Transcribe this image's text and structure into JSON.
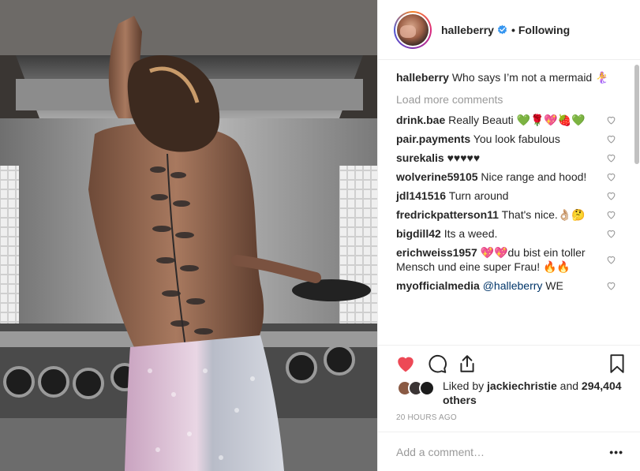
{
  "post": {
    "author": "halleberry",
    "follow_state": "Following",
    "separator": "•",
    "caption": {
      "user": "halleberry",
      "text": "Who says I’m not a mermaid 🧜‍♀️"
    },
    "load_more": "Load more comments",
    "comments": [
      {
        "user": "drink.bae",
        "text": "Really Beauti 💚🌹💖🍓💚"
      },
      {
        "user": "pair.payments",
        "text": "You look fabulous"
      },
      {
        "user": "surekalis",
        "text": "♥♥♥♥♥"
      },
      {
        "user": "wolverine59105",
        "text": "Nice range and hood!"
      },
      {
        "user": "jdl141516",
        "text": "Turn around"
      },
      {
        "user": "fredrickpatterson11",
        "text": "That's nice.👌🏼🤔"
      },
      {
        "user": "bigdill42",
        "text": "Its a weed."
      },
      {
        "user": "erichweiss1957",
        "text": "💖💖du bist ein toller Mensch und eine super Frau! 🔥🔥"
      },
      {
        "user": "myofficialmedia",
        "mention": "@halleberry",
        "text": "WE"
      }
    ],
    "likes": {
      "prefix": "Liked by",
      "liker": "jackiechristie",
      "and": "and",
      "others": "294,404 others"
    },
    "timestamp": "20 HOURS AGO",
    "add_comment_placeholder": "Add a comment…",
    "more_label": "•••",
    "icons": {
      "like": "heart-filled-icon",
      "comment": "comment-icon",
      "share": "share-icon",
      "save": "bookmark-icon",
      "verified": "verified-badge-icon",
      "comment_like": "heart-outline-icon"
    },
    "colors": {
      "like_red": "#ed4956",
      "verified_blue": "#3897f0",
      "muted_text": "#999999",
      "mention_blue": "#003569"
    }
  }
}
